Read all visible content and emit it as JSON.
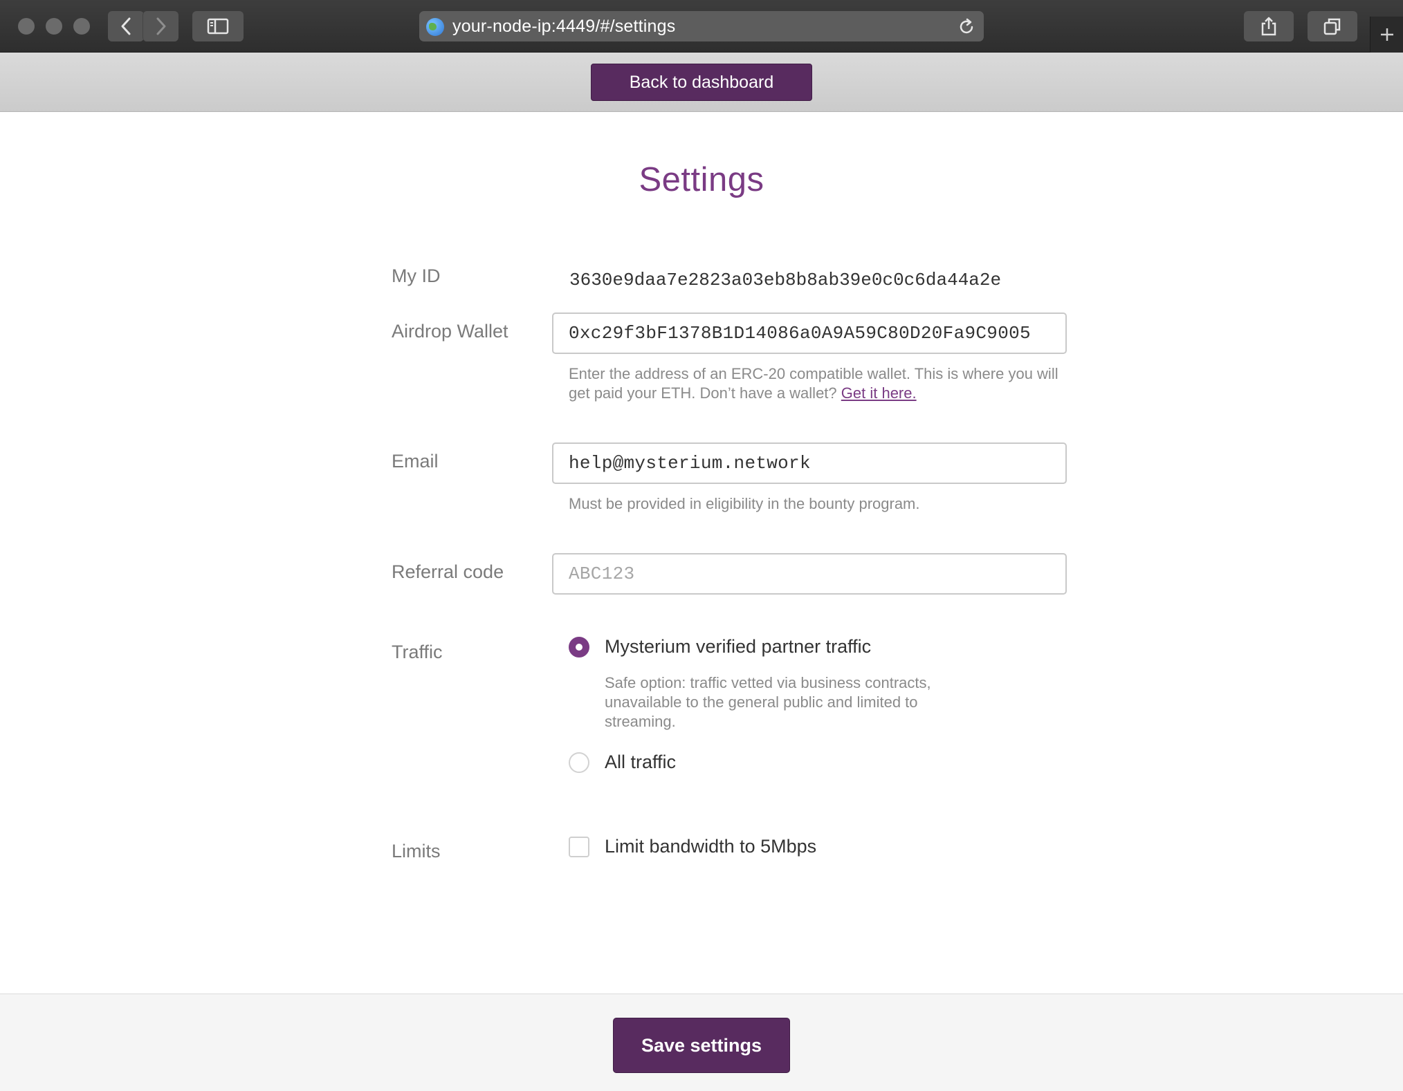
{
  "browser": {
    "url": "your-node-ip:4449/#/settings"
  },
  "header": {
    "back_label": "Back to dashboard"
  },
  "page": {
    "title": "Settings"
  },
  "form": {
    "my_id": {
      "label": "My ID",
      "value": "3630e9daa7e2823a03eb8b8ab39e0c0c6da44a2e"
    },
    "wallet": {
      "label": "Airdrop Wallet",
      "value": "0xc29f3bF1378B1D14086a0A9A59C80D20Fa9C9005",
      "hint": "Enter the address of an ERC-20 compatible wallet. This is where you will get paid your ETH. Don’t have a wallet?",
      "hint_link": "Get it here."
    },
    "email": {
      "label": "Email",
      "value": "help@mysterium.network",
      "hint": "Must be provided in eligibility in the bounty program."
    },
    "referral": {
      "label": "Referral code",
      "value": "",
      "placeholder": "ABC123"
    },
    "traffic": {
      "label": "Traffic",
      "options": [
        {
          "label": "Mysterium verified partner traffic",
          "description": "Safe option: traffic vetted via business contracts, unavailable to the general public and limited to streaming.",
          "selected": true
        },
        {
          "label": "All traffic",
          "selected": false
        }
      ]
    },
    "limits": {
      "label": "Limits",
      "checkbox_label": "Limit bandwidth to 5Mbps",
      "checked": false
    }
  },
  "footer": {
    "save_label": "Save settings"
  },
  "colors": {
    "accent": "#582b5f",
    "title": "#7a3b84"
  }
}
